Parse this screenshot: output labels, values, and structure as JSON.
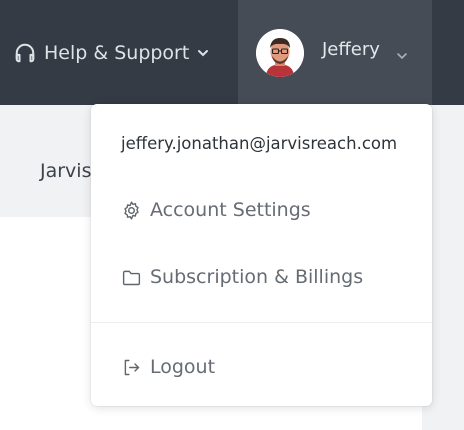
{
  "header": {
    "help_label": "Help & Support",
    "user_name": "Jeffery"
  },
  "subheader": {
    "truncated_title": "Jarvis"
  },
  "dropdown": {
    "email": "jeffery.jonathan@jarvisreach.com",
    "items": [
      {
        "label": "Account Settings",
        "icon": "gear-icon"
      },
      {
        "label": "Subscription & Billings",
        "icon": "folder-icon"
      },
      {
        "label": "Logout",
        "icon": "logout-icon"
      }
    ]
  },
  "colors": {
    "topbar": "#343b45",
    "user_area": "#454c56",
    "subbar": "#f1f2f4"
  }
}
